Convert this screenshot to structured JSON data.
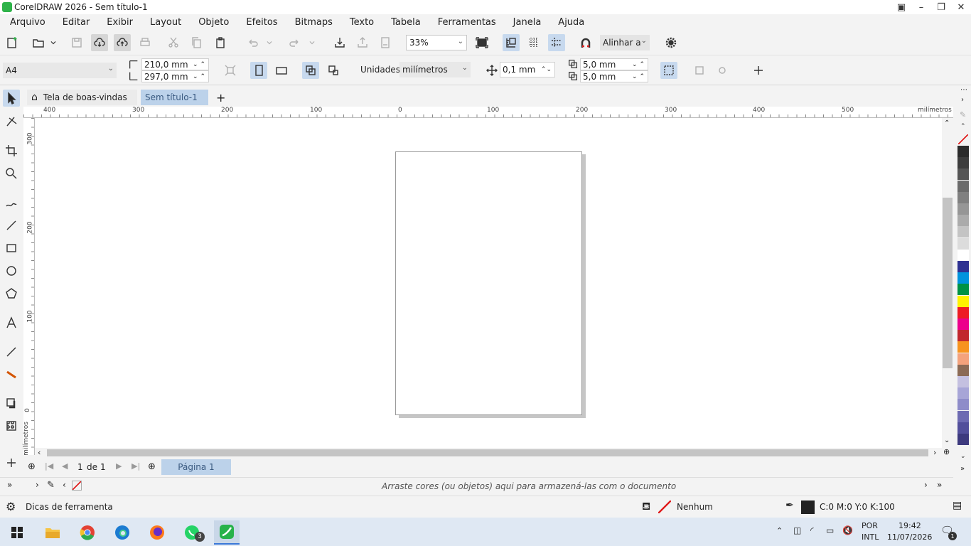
{
  "window": {
    "title": "CorelDRAW 2026 - Sem título-1"
  },
  "menu": [
    "Arquivo",
    "Editar",
    "Exibir",
    "Layout",
    "Objeto",
    "Efeitos",
    "Bitmaps",
    "Texto",
    "Tabela",
    "Ferramentas",
    "Janela",
    "Ajuda"
  ],
  "toolbar": {
    "zoom": "33%",
    "align_label": "Alinhar a"
  },
  "property_bar": {
    "page_size": "A4",
    "width": "210,0 mm",
    "height": "297,0 mm",
    "units_label": "Unidades:",
    "units_value": "milímetros",
    "nudge": "0,1 mm",
    "dup_x": "5,0 mm",
    "dup_y": "5,0 mm"
  },
  "tabs": {
    "welcome": "Tela de boas-vindas",
    "document": "Sem título-1"
  },
  "ruler": {
    "h_ticks": [
      "400",
      "300",
      "200",
      "100",
      "0",
      "100",
      "200",
      "300",
      "400",
      "500"
    ],
    "h_unit": "milímetros",
    "v_ticks": [
      "300",
      "200",
      "100",
      "0"
    ],
    "v_unit": "milímetros"
  },
  "pagenav": {
    "current": "1",
    "of": "de",
    "total": "1",
    "page_tab": "Página 1"
  },
  "doc_palette": {
    "hint": "Arraste cores (ou objetos) aqui para armazená-las com o documento"
  },
  "status": {
    "hints": "Dicas de ferramenta",
    "fill": "Nenhum",
    "outline": "C:0 M:0 Y:0 K:100"
  },
  "palette_colors": [
    "#2b2b2b",
    "#3d3d3d",
    "#555555",
    "#6b6b6b",
    "#808080",
    "#969696",
    "#ababab",
    "#c4c4c4",
    "#dcdcdc",
    "#ffffff",
    "#2e3192",
    "#0093dd",
    "#009245",
    "#fff200",
    "#ed1c24",
    "#ec008c",
    "#c1272d",
    "#f7931e",
    "#f4a27c",
    "#8b6a55",
    "#c4c0e0",
    "#a7a5d7",
    "#8e8cc9",
    "#6d6ab2",
    "#524f9b",
    "#3d3a7e"
  ],
  "taskbar": {
    "lang1": "POR",
    "lang2": "INTL",
    "time": "19:42",
    "date": "11/07/2026",
    "whatsapp_badge": "3",
    "notif": "1"
  }
}
